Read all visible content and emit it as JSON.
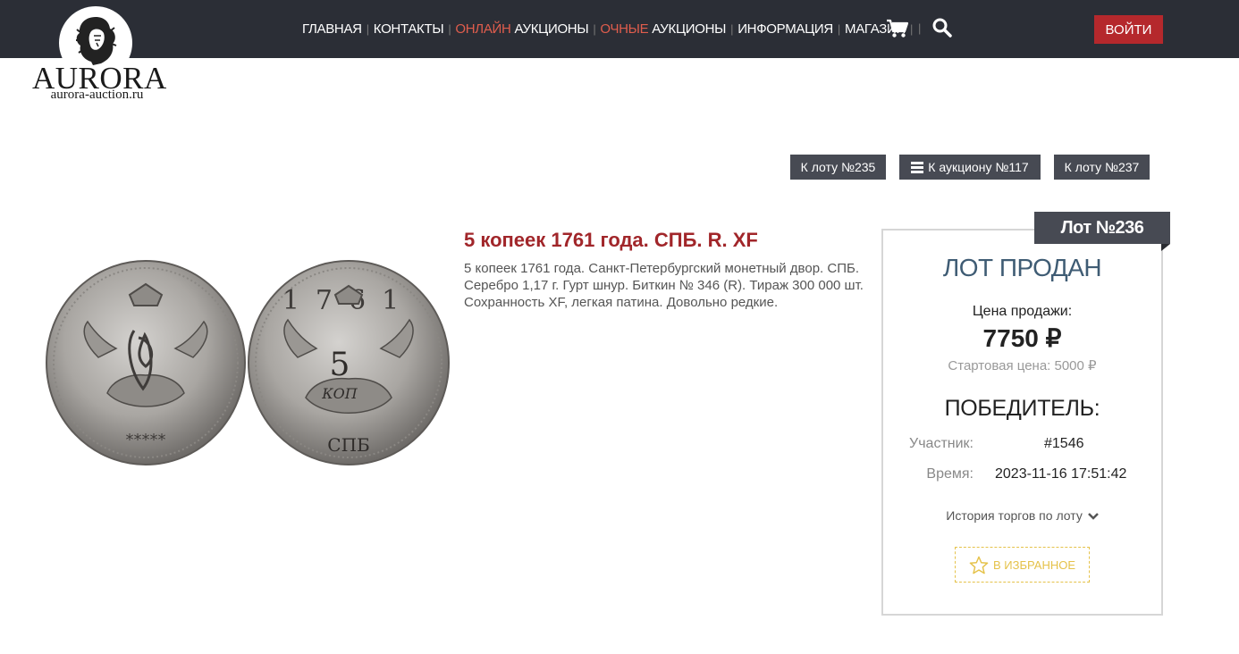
{
  "header": {
    "logo_text": "AURORA",
    "logo_sub": "aurora-auction.ru",
    "nav": [
      {
        "label": "ГЛАВНАЯ"
      },
      {
        "label": "КОНТАКТЫ"
      },
      {
        "accent": "ОНЛАЙН",
        "label": "АУКЦИОНЫ"
      },
      {
        "accent": "ОЧНЫЕ",
        "label": "АУКЦИОНЫ"
      },
      {
        "label": "ИНФОРМАЦИЯ"
      },
      {
        "label": "МАГАЗИН"
      }
    ],
    "login_label": "ВОЙТИ"
  },
  "lot_nav": {
    "prev_label": "К лоту №235",
    "auction_label": "К аукциону №117",
    "next_label": "К лоту №237"
  },
  "lot": {
    "title": "5 копеек 1761 года. СПБ. R. XF",
    "description": "5 копеек 1761 года. Санкт-Петербургский монетный двор. СПБ. Серебро 1,17 г. Гурт шнур. Биткин № 346 (R). Тираж 300 000 шт. Сохранность XF, легкая патина. Довольно редкие.",
    "coin_obverse_marks": "*****",
    "coin_reverse_year": "1761",
    "coin_reverse_value": "5",
    "coin_reverse_unit": "КОП",
    "coin_reverse_mint": "СПБ"
  },
  "panel": {
    "lot_number": "Лот №236",
    "status": "ЛОТ ПРОДАН",
    "price_label": "Цена продажи:",
    "price": "7750 ₽",
    "start_price": "Стартовая цена: 5000 ₽",
    "winner_heading": "ПОБЕДИТЕЛЬ:",
    "participant_label": "Участник:",
    "participant_value": "#1546",
    "time_label": "Время:",
    "time_value": "2023-11-16 17:51:42",
    "history_label": "История торгов по лоту",
    "favorite_label": "В ИЗБРАННОЕ"
  },
  "colors": {
    "header_bg": "#2b2e36",
    "accent_red": "#a1262a",
    "nav_accent": "#e05d4d",
    "login_bg": "#b5282c",
    "button_bg": "#474a53",
    "status_blue": "#3f5c74",
    "favorite_gold": "#e5c24a"
  },
  "icons": [
    "lion-logo-icon",
    "cart-icon",
    "search-icon",
    "menu-icon",
    "chevron-down-icon",
    "star-icon"
  ]
}
